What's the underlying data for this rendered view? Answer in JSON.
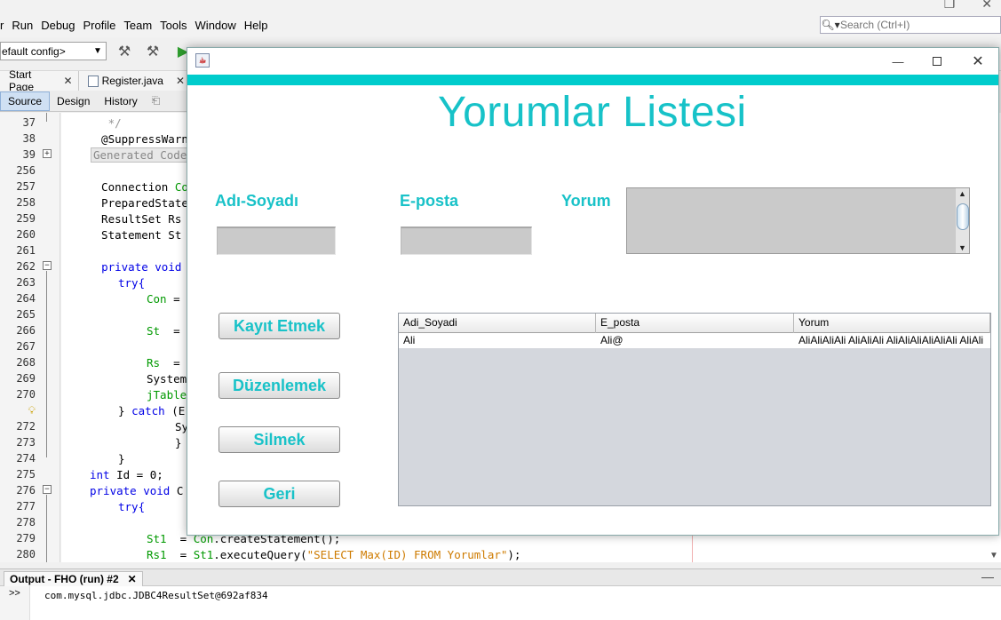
{
  "ide": {
    "menu": [
      "r",
      "Run",
      "Debug",
      "Profile",
      "Team",
      "Tools",
      "Window",
      "Help"
    ],
    "search_placeholder": "Search (Ctrl+I)",
    "config": "efault config>",
    "tabs": [
      "Start Page",
      "Register.java"
    ],
    "subtabs": [
      "Source",
      "Design",
      "History"
    ],
    "line_numbers": [
      "37",
      "38",
      "39",
      "256",
      "257",
      "258",
      "259",
      "260",
      "261",
      "262",
      "263",
      "264",
      "265",
      "266",
      "267",
      "268",
      "269",
      "270",
      "",
      "272",
      "273",
      "274",
      "275",
      "276",
      "277",
      "278",
      "279",
      "280"
    ],
    "code": {
      "l37": "   */",
      "l38": "  @SuppressWarni",
      "l39": "Generated Code",
      "l257a": "  Connection ",
      "l257b": "Cor",
      "l258": "  PreparedStaten",
      "l259": "  ResultSet Rs =",
      "l260": "  Statement St =",
      "l262a": "  ",
      "l262b": "private void",
      "l262c": " D",
      "l263": "try{",
      "l264a": "Con",
      "l264b": " =",
      "l266a": "St",
      "l266b": "  =",
      "l268a": "Rs",
      "l268b": "  =",
      "l269": "System",
      "l270": "jTable",
      "l271a": "} ",
      "l271b": "catch",
      "l271c": " (E",
      "l272": "Sy",
      "l273": "}",
      "l274": "}",
      "l275a": "int",
      "l275b": " Id = 0;",
      "l276a": "private void",
      "l276b": " C",
      "l277": "try{",
      "l279a": "St1",
      "l279b": "  = ",
      "l279c": "Con",
      "l279d": ".createStatement();",
      "l280a": "Rs1",
      "l280b": "  = ",
      "l280c": "St1",
      "l280d": ".executeQuery(",
      "l280e": "\"SELECT Max(ID) FROM Yorumlar\"",
      "l280f": ");"
    },
    "output_tab": "Output - FHO (run) #2",
    "output_prompt": ">>",
    "output_text": "com.mysql.jdbc.JDBC4ResultSet@692af834"
  },
  "app": {
    "title": "Yorumlar Listesi",
    "labels": {
      "name": "Adı-Soyadı",
      "email": "E-posta",
      "comment": "Yorum"
    },
    "fields": {
      "name_value": "",
      "email_value": "",
      "comment_value": ""
    },
    "buttons": {
      "save": "Kayıt Etmek",
      "edit": "Düzenlemek",
      "delete": "Silmek",
      "back": "Geri"
    },
    "table": {
      "columns": [
        "Adi_Soyadi",
        "E_posta",
        "Yorum"
      ],
      "rows": [
        [
          "Ali",
          "Ali@",
          "AliAliAliAli AliAliAli AliAliAliAliAliAli AliAli"
        ]
      ]
    }
  },
  "colors": {
    "accent_teal": "#19c2c8",
    "title_bar_stripe": "#00cccc"
  }
}
